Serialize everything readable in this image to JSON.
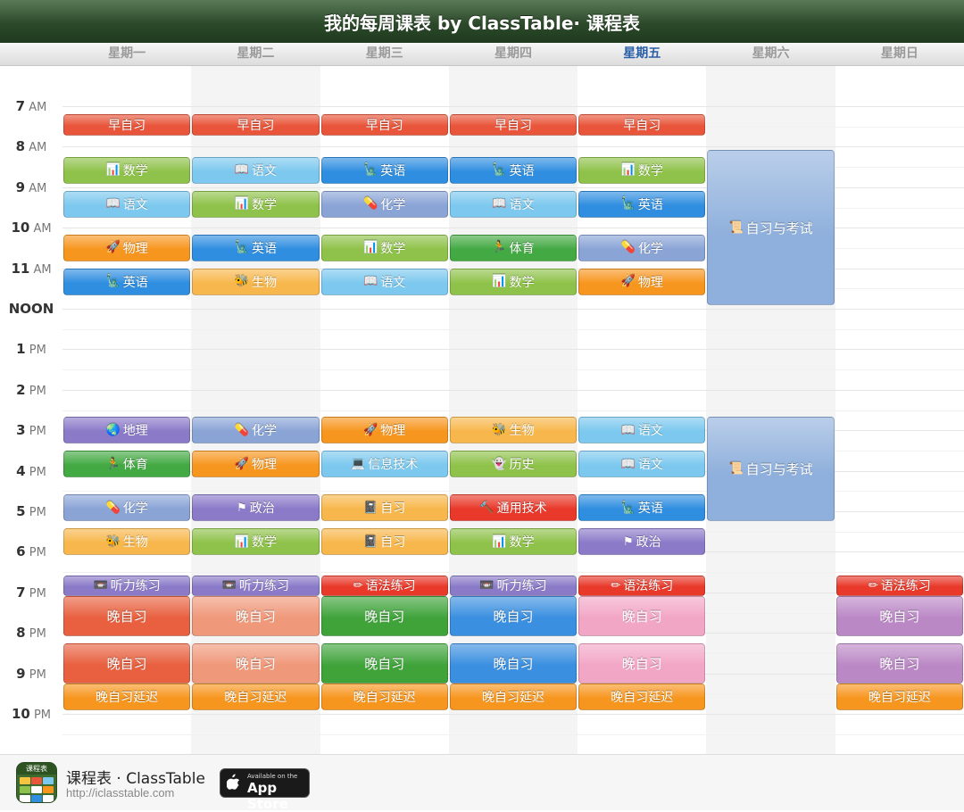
{
  "window": {
    "title": "我的每周课表 by ClassTable· 课程表"
  },
  "days": [
    "星期一",
    "星期二",
    "星期三",
    "星期四",
    "星期五",
    "星期六",
    "星期日"
  ],
  "today_index": 4,
  "hours": [
    {
      "num": "7",
      "ampm": "AM"
    },
    {
      "num": "8",
      "ampm": "AM"
    },
    {
      "num": "9",
      "ampm": "AM"
    },
    {
      "num": "10",
      "ampm": "AM"
    },
    {
      "num": "11",
      "ampm": "AM"
    },
    {
      "num": "NOON",
      "ampm": ""
    },
    {
      "num": "1",
      "ampm": "PM"
    },
    {
      "num": "2",
      "ampm": "PM"
    },
    {
      "num": "3",
      "ampm": "PM"
    },
    {
      "num": "4",
      "ampm": "PM"
    },
    {
      "num": "5",
      "ampm": "PM"
    },
    {
      "num": "6",
      "ampm": "PM"
    },
    {
      "num": "7",
      "ampm": "PM"
    },
    {
      "num": "8",
      "ampm": "PM"
    },
    {
      "num": "9",
      "ampm": "PM"
    },
    {
      "num": "10",
      "ampm": "PM"
    }
  ],
  "subjects": {
    "早自习": {
      "color": "#e8553a",
      "icon": ""
    },
    "数学": {
      "color": "#8fc24a",
      "icon": "chart-icon"
    },
    "语文": {
      "color": "#7cc8ee",
      "icon": "book-icon"
    },
    "英语": {
      "color": "#2f8ee0",
      "icon": "statue-of-liberty-icon"
    },
    "化学": {
      "color": "#8aa4d6",
      "icon": "pill-icon"
    },
    "物理": {
      "color": "#f7961f",
      "icon": "rocket-icon"
    },
    "体育": {
      "color": "#43a943",
      "icon": "runner-icon"
    },
    "生物": {
      "color": "#f8b74c",
      "icon": "bee-icon"
    },
    "地理": {
      "color": "#8a7ac8",
      "icon": "globe-icon"
    },
    "信息技术": {
      "color": "#7cc8ee",
      "icon": "computer-icon"
    },
    "历史": {
      "color": "#8fc24a",
      "icon": "ghost-icon"
    },
    "政治": {
      "color": "#8a7ac8",
      "icon": "china-flag-icon"
    },
    "自习": {
      "color": "#f8b74c",
      "icon": "notebook-icon"
    },
    "通用技术": {
      "color": "#e8392a",
      "icon": "hammer-icon"
    },
    "听力练习": {
      "color": "#8a7ac8",
      "icon": "cassette-icon"
    },
    "语法练习": {
      "color": "#e8392a",
      "icon": "pencil-icon"
    },
    "自习与考试": {
      "color": "#8fb0dc",
      "icon": "scroll-icon"
    },
    "晚自习延迟": {
      "color": "#f7961f",
      "icon": ""
    }
  },
  "classes": [
    {
      "day": 0,
      "start": "07:12",
      "end": "07:43",
      "name": "早自习"
    },
    {
      "day": 1,
      "start": "07:12",
      "end": "07:43",
      "name": "早自习"
    },
    {
      "day": 2,
      "start": "07:12",
      "end": "07:43",
      "name": "早自习"
    },
    {
      "day": 3,
      "start": "07:12",
      "end": "07:43",
      "name": "早自习"
    },
    {
      "day": 4,
      "start": "07:12",
      "end": "07:43",
      "name": "早自习"
    },
    {
      "day": 0,
      "start": "08:15",
      "end": "08:55",
      "name": "数学"
    },
    {
      "day": 1,
      "start": "08:15",
      "end": "08:55",
      "name": "语文"
    },
    {
      "day": 2,
      "start": "08:15",
      "end": "08:55",
      "name": "英语"
    },
    {
      "day": 3,
      "start": "08:15",
      "end": "08:55",
      "name": "英语"
    },
    {
      "day": 4,
      "start": "08:15",
      "end": "08:55",
      "name": "数学"
    },
    {
      "day": 0,
      "start": "09:05",
      "end": "09:45",
      "name": "语文"
    },
    {
      "day": 1,
      "start": "09:05",
      "end": "09:45",
      "name": "数学"
    },
    {
      "day": 2,
      "start": "09:05",
      "end": "09:45",
      "name": "化学"
    },
    {
      "day": 3,
      "start": "09:05",
      "end": "09:45",
      "name": "语文"
    },
    {
      "day": 4,
      "start": "09:05",
      "end": "09:45",
      "name": "英语"
    },
    {
      "day": 0,
      "start": "10:10",
      "end": "10:50",
      "name": "物理"
    },
    {
      "day": 1,
      "start": "10:10",
      "end": "10:50",
      "name": "英语"
    },
    {
      "day": 2,
      "start": "10:10",
      "end": "10:50",
      "name": "数学"
    },
    {
      "day": 3,
      "start": "10:10",
      "end": "10:50",
      "name": "体育"
    },
    {
      "day": 4,
      "start": "10:10",
      "end": "10:50",
      "name": "化学"
    },
    {
      "day": 0,
      "start": "11:00",
      "end": "11:40",
      "name": "英语"
    },
    {
      "day": 1,
      "start": "11:00",
      "end": "11:40",
      "name": "生物"
    },
    {
      "day": 2,
      "start": "11:00",
      "end": "11:40",
      "name": "语文"
    },
    {
      "day": 3,
      "start": "11:00",
      "end": "11:40",
      "name": "数学"
    },
    {
      "day": 4,
      "start": "11:00",
      "end": "11:40",
      "name": "物理"
    },
    {
      "day": 5,
      "start": "08:05",
      "end": "11:55",
      "name": "自习与考试"
    },
    {
      "day": 0,
      "start": "14:40",
      "end": "15:20",
      "name": "地理"
    },
    {
      "day": 1,
      "start": "14:40",
      "end": "15:20",
      "name": "化学"
    },
    {
      "day": 2,
      "start": "14:40",
      "end": "15:20",
      "name": "物理"
    },
    {
      "day": 3,
      "start": "14:40",
      "end": "15:20",
      "name": "生物"
    },
    {
      "day": 4,
      "start": "14:40",
      "end": "15:20",
      "name": "语文"
    },
    {
      "day": 0,
      "start": "15:30",
      "end": "16:10",
      "name": "体育"
    },
    {
      "day": 1,
      "start": "15:30",
      "end": "16:10",
      "name": "物理"
    },
    {
      "day": 2,
      "start": "15:30",
      "end": "16:10",
      "name": "信息技术"
    },
    {
      "day": 3,
      "start": "15:30",
      "end": "16:10",
      "name": "历史"
    },
    {
      "day": 4,
      "start": "15:30",
      "end": "16:10",
      "name": "语文"
    },
    {
      "day": 0,
      "start": "16:35",
      "end": "17:15",
      "name": "化学"
    },
    {
      "day": 1,
      "start": "16:35",
      "end": "17:15",
      "name": "政治"
    },
    {
      "day": 2,
      "start": "16:35",
      "end": "17:15",
      "name": "自习"
    },
    {
      "day": 3,
      "start": "16:35",
      "end": "17:15",
      "name": "通用技术"
    },
    {
      "day": 4,
      "start": "16:35",
      "end": "17:15",
      "name": "英语"
    },
    {
      "day": 0,
      "start": "17:25",
      "end": "18:05",
      "name": "生物"
    },
    {
      "day": 1,
      "start": "17:25",
      "end": "18:05",
      "name": "数学"
    },
    {
      "day": 2,
      "start": "17:25",
      "end": "18:05",
      "name": "自习"
    },
    {
      "day": 3,
      "start": "17:25",
      "end": "18:05",
      "name": "数学"
    },
    {
      "day": 4,
      "start": "17:25",
      "end": "18:05",
      "name": "政治"
    },
    {
      "day": 5,
      "start": "14:40",
      "end": "17:15",
      "name": "自习与考试"
    },
    {
      "day": 0,
      "start": "18:35",
      "end": "19:05",
      "name": "听力练习"
    },
    {
      "day": 1,
      "start": "18:35",
      "end": "19:05",
      "name": "听力练习"
    },
    {
      "day": 2,
      "start": "18:35",
      "end": "19:05",
      "name": "语法练习"
    },
    {
      "day": 3,
      "start": "18:35",
      "end": "19:05",
      "name": "听力练习"
    },
    {
      "day": 4,
      "start": "18:35",
      "end": "19:05",
      "name": "语法练习"
    },
    {
      "day": 6,
      "start": "18:35",
      "end": "19:05",
      "name": "语法练习"
    },
    {
      "day": 0,
      "start": "19:05",
      "end": "20:05",
      "name": "晚自习",
      "color": "#e8603f"
    },
    {
      "day": 1,
      "start": "19:05",
      "end": "20:05",
      "name": "晚自习",
      "color": "#f0987a"
    },
    {
      "day": 2,
      "start": "19:05",
      "end": "20:05",
      "name": "晚自习",
      "color": "#3fa33a"
    },
    {
      "day": 3,
      "start": "19:05",
      "end": "20:05",
      "name": "晚自习",
      "color": "#3a8fe0"
    },
    {
      "day": 4,
      "start": "19:05",
      "end": "20:05",
      "name": "晚自习",
      "color": "#f2a6c6"
    },
    {
      "day": 6,
      "start": "19:05",
      "end": "20:05",
      "name": "晚自习",
      "color": "#bb88c6"
    },
    {
      "day": 0,
      "start": "20:15",
      "end": "21:15",
      "name": "晚自习",
      "color": "#e8603f"
    },
    {
      "day": 1,
      "start": "20:15",
      "end": "21:15",
      "name": "晚自习",
      "color": "#f0987a"
    },
    {
      "day": 2,
      "start": "20:15",
      "end": "21:15",
      "name": "晚自习",
      "color": "#3fa33a"
    },
    {
      "day": 3,
      "start": "20:15",
      "end": "21:15",
      "name": "晚自习",
      "color": "#3a8fe0"
    },
    {
      "day": 4,
      "start": "20:15",
      "end": "21:15",
      "name": "晚自习",
      "color": "#f2a6c6"
    },
    {
      "day": 6,
      "start": "20:15",
      "end": "21:15",
      "name": "晚自习",
      "color": "#bb88c6"
    },
    {
      "day": 0,
      "start": "21:15",
      "end": "21:55",
      "name": "晚自习延迟"
    },
    {
      "day": 1,
      "start": "21:15",
      "end": "21:55",
      "name": "晚自习延迟"
    },
    {
      "day": 2,
      "start": "21:15",
      "end": "21:55",
      "name": "晚自习延迟"
    },
    {
      "day": 3,
      "start": "21:15",
      "end": "21:55",
      "name": "晚自习延迟"
    },
    {
      "day": 4,
      "start": "21:15",
      "end": "21:55",
      "name": "晚自习延迟"
    },
    {
      "day": 6,
      "start": "21:15",
      "end": "21:55",
      "name": "晚自习延迟"
    }
  ],
  "footer": {
    "app_name": "课程表 · ClassTable",
    "url": "http://iclasstable.com",
    "icon_label": "课程表",
    "store_small": "Available on the",
    "store_large": "App Store"
  }
}
